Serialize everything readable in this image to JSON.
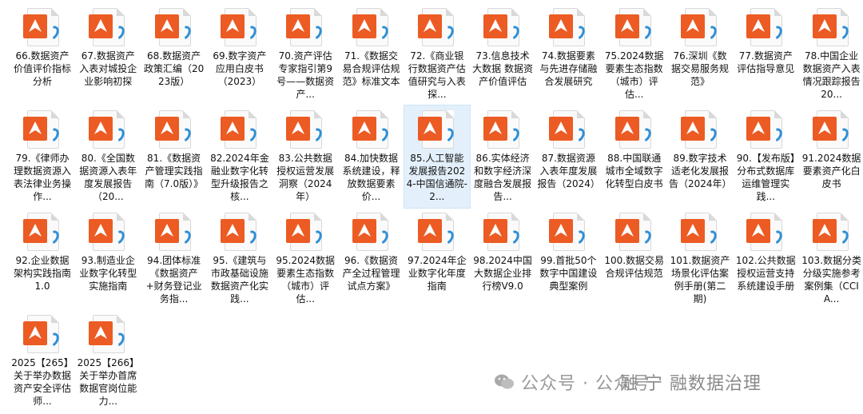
{
  "files": [
    {
      "label": "66.数据资产价值评价指标分析"
    },
    {
      "label": "67.数据资产入表对城投企业影响初探"
    },
    {
      "label": "68.数据资产政策汇编（2023版）"
    },
    {
      "label": "69.数字资产应用白皮书（2023）"
    },
    {
      "label": "70.资产评估专家指引第9号——数据资产..."
    },
    {
      "label": "71.《数据交易合规评估规范》标准文本"
    },
    {
      "label": "72.《商业银行数据资产估值研究与入表探..."
    },
    {
      "label": "73.信息技术 大数据 数据资产价值评估"
    },
    {
      "label": "74.数据要素与先进存储融合发展研究"
    },
    {
      "label": "75.2024数据要素生态指数（城市）评估..."
    },
    {
      "label": "76.深圳《数据交易服务规范》"
    },
    {
      "label": "77.数据资产评估指导意见"
    },
    {
      "label": "78.中国企业数据资产入表情况跟踪报告20..."
    },
    {
      "label": "79.《律师办理数据资源入表法律业务操作..."
    },
    {
      "label": "80.《全国数据资源入表年度发展报告（20..."
    },
    {
      "label": "81.《数据资产管理实践指南（7.0版）》"
    },
    {
      "label": "82.2024年金融业数字化转型升级报告之核..."
    },
    {
      "label": "83.公共数据授权运营发展洞察（2024年）"
    },
    {
      "label": "84.加快数据系统建设，释放数据要素价..."
    },
    {
      "label": "85.人工智能发展报告2024-中国信通院-2..."
    },
    {
      "label": "86.实体经济和数字经济深度融合发展报告..."
    },
    {
      "label": "87.数据资源入表年度发展报告（2024）"
    },
    {
      "label": "88.中国联通城市全域数字化转型白皮书"
    },
    {
      "label": "89.数字技术适老化发展报告（2024年）"
    },
    {
      "label": "90.【发布版】分布式数据库运维管理实践..."
    },
    {
      "label": "91.2024数据要素资产化白皮书"
    },
    {
      "label": "92.企业数据架构实践指南1.0"
    },
    {
      "label": "93.制造业企业数字化转型实施指南"
    },
    {
      "label": "94.团体标准《数据资产+财务登记业务指..."
    },
    {
      "label": "95.《建筑与市政基础设施数据资产化实践..."
    },
    {
      "label": "95.2024数据要素生态指数（城市）评估..."
    },
    {
      "label": "96.《数据资产全过程管理试点方案》"
    },
    {
      "label": "97.2024年企业数字化年度指南"
    },
    {
      "label": "98.2024中国大数据企业排行榜V9.0"
    },
    {
      "label": "99.首批50个数字中国建设典型案例"
    },
    {
      "label": "100.数据交易合规评估规范"
    },
    {
      "label": "101.数据资产场景化评估案例手册(第二期)"
    },
    {
      "label": "102.公共数据授权运营支持系统建设手册"
    },
    {
      "label": "103.数据分类分级实施参考案例集（CCIA..."
    },
    {
      "label": "2025【265】关于举办数据资产安全评估师..."
    },
    {
      "label": "2025【266】关于举办首席数据官岗位能力..."
    }
  ],
  "watermark": {
    "text1": "公众号 · 公众号",
    "text2": "融 宁 融数据治理"
  },
  "colors": {
    "badge": "#ec5b23",
    "arc": "#2f8fd6",
    "selected": "#e3f0fb"
  },
  "selected_index": 19
}
